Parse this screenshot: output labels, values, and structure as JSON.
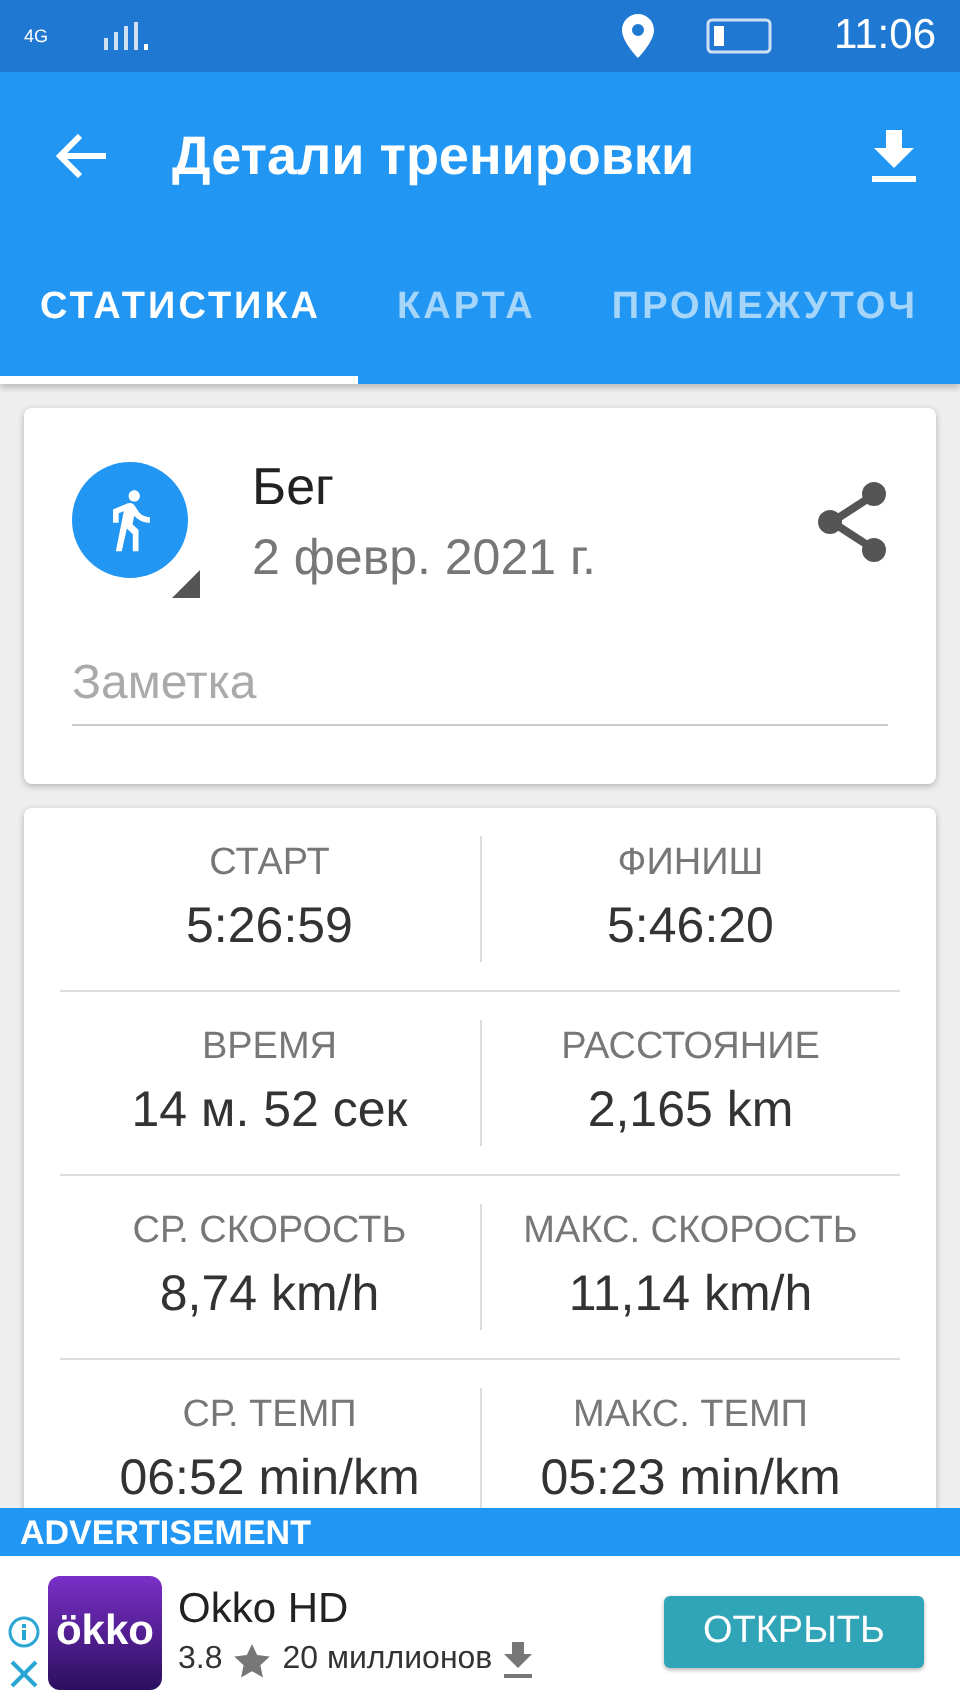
{
  "status_bar": {
    "network": "4G",
    "time": "11:06"
  },
  "toolbar": {
    "title": "Детали тренировки"
  },
  "tabs": [
    {
      "label": "СТАТИСТИКА",
      "selected": true
    },
    {
      "label": "КАРТА",
      "selected": false
    },
    {
      "label": "ПРОМЕЖУТОЧ",
      "selected": false
    }
  ],
  "workout": {
    "type": "Бег",
    "date": "2 февр. 2021 г.",
    "note": {
      "placeholder": "Заметка"
    }
  },
  "stats": [
    [
      {
        "label": "СТАРТ",
        "value": "5:26:59"
      },
      {
        "label": "ФИНИШ",
        "value": "5:46:20"
      }
    ],
    [
      {
        "label": "ВРЕМЯ",
        "value": "14 м. 52 сек"
      },
      {
        "label": "РАССТОЯНИЕ",
        "value": "2,165 km"
      }
    ],
    [
      {
        "label": "СР. СКОРОСТЬ",
        "value": "8,74 km/h"
      },
      {
        "label": "МАКС. СКОРОСТЬ",
        "value": "11,14 km/h"
      }
    ],
    [
      {
        "label": "СР. ТЕМП",
        "value": "06:52 min/km"
      },
      {
        "label": "МАКС. ТЕМП",
        "value": "05:23 min/km"
      }
    ]
  ],
  "ad": {
    "header": "ADVERTISEMENT",
    "logo": "ökko",
    "app": "Okko HD",
    "rating": "3.8",
    "installs": "20 миллионов",
    "button": "ОТКРЫТЬ"
  }
}
